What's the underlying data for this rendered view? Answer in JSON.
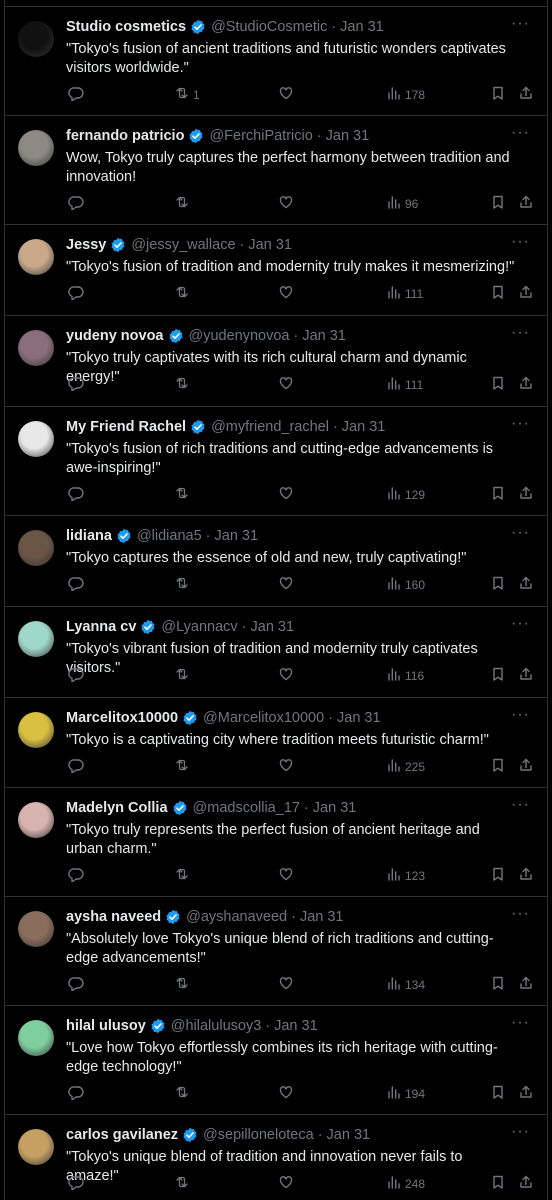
{
  "tweets": [
    {
      "name": "Studio cosmetics",
      "handle": "@StudioCosmetic",
      "date": "Jan 31",
      "text": "\"Tokyo's fusion of ancient traditions and futuristic wonders captivates visitors worldwide.\"",
      "replies": "",
      "retweets": "1",
      "likes": "",
      "views": "178",
      "avatar_color": "#111111"
    },
    {
      "name": "fernando patricio",
      "handle": "@FerchiPatricio",
      "date": "Jan 31",
      "text": "Wow, Tokyo truly captures the perfect harmony between tradition and innovation!",
      "replies": "",
      "retweets": "",
      "likes": "",
      "views": "96",
      "avatar_color": "#8c8a82"
    },
    {
      "name": "Jessy",
      "handle": "@jessy_wallace",
      "date": "Jan 31",
      "text": "\"Tokyo's fusion of tradition and modernity truly makes it mesmerizing!\"",
      "replies": "",
      "retweets": "",
      "likes": "",
      "views": "111",
      "avatar_color": "#c9a98a"
    },
    {
      "name": "yudeny novoa",
      "handle": "@yudenynovoa",
      "date": "Jan 31",
      "text": "\"Tokyo truly captivates with its rich cultural charm and dynamic energy!\"",
      "replies": "",
      "retweets": "",
      "likes": "",
      "views": "111",
      "avatar_color": "#8a6f7a"
    },
    {
      "name": "My Friend Rachel",
      "handle": "@myfriend_rachel",
      "date": "Jan 31",
      "text": "\"Tokyo's fusion of rich traditions and cutting-edge advancements is awe-inspiring!\"",
      "replies": "",
      "retweets": "",
      "likes": "",
      "views": "129",
      "avatar_color": "#e8e8e8"
    },
    {
      "name": "lidiana",
      "handle": "@lidiana5",
      "date": "Jan 31",
      "text": "\"Tokyo captures the essence of old and new, truly captivating!\"",
      "replies": "",
      "retweets": "",
      "likes": "",
      "views": "160",
      "avatar_color": "#6b5546"
    },
    {
      "name": "Lyanna cv",
      "handle": "@Lyannacv",
      "date": "Jan 31",
      "text": "\"Tokyo's vibrant fusion of tradition and modernity truly captivates visitors.\"",
      "replies": "",
      "retweets": "",
      "likes": "",
      "views": "116",
      "avatar_color": "#9fd8c8"
    },
    {
      "name": "Marcelitox10000",
      "handle": "@Marcelitox10000",
      "date": "Jan 31",
      "text": "\"Tokyo is a captivating city where tradition meets futuristic charm!\"",
      "replies": "",
      "retweets": "",
      "likes": "",
      "views": "225",
      "avatar_color": "#d9c041"
    },
    {
      "name": "Madelyn Collia",
      "handle": "@madscollia_17",
      "date": "Jan 31",
      "text": "\"Tokyo truly represents the perfect fusion of ancient heritage and urban charm.\"",
      "replies": "",
      "retweets": "",
      "likes": "",
      "views": "123",
      "avatar_color": "#d8b4b0"
    },
    {
      "name": "aysha naveed",
      "handle": "@ayshanaveed",
      "date": "Jan 31",
      "text": "\"Absolutely love Tokyo's unique blend of rich traditions and cutting-edge advancements!\"",
      "replies": "",
      "retweets": "",
      "likes": "",
      "views": "134",
      "avatar_color": "#8a6d5c"
    },
    {
      "name": "hilal ulusoy",
      "handle": "@hilalulusoy3",
      "date": "Jan 31",
      "text": "\"Love how Tokyo effortlessly combines its rich heritage with cutting-edge technology!\"",
      "replies": "",
      "retweets": "",
      "likes": "",
      "views": "194",
      "avatar_color": "#7fcf9e"
    },
    {
      "name": "carlos gavilanez",
      "handle": "@sepilloneloteca",
      "date": "Jan 31",
      "text": "\"Tokyo's unique blend of tradition and innovation never fails to amaze!\"",
      "replies": "",
      "retweets": "",
      "likes": "",
      "views": "248",
      "avatar_color": "#c6a062"
    }
  ],
  "ui": {
    "sep": "·",
    "more_glyph": "···",
    "verified_color": "#1d9bf0"
  }
}
